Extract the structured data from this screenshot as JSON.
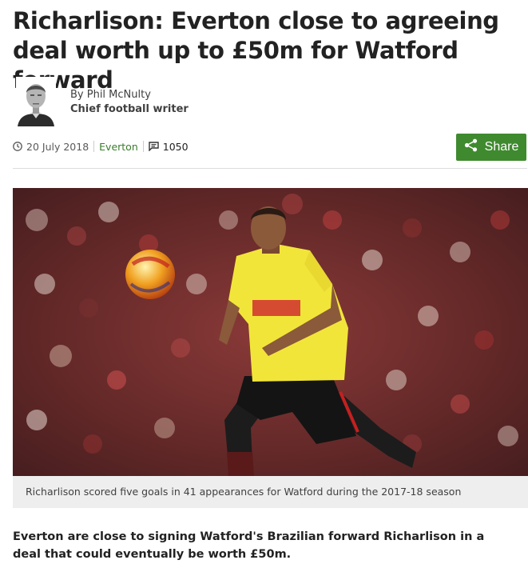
{
  "article": {
    "headline": "Richarlison: Everton close to agreeing deal worth up to £50m for Watford forward",
    "author": "By Phil McNulty",
    "author_role": "Chief football writer",
    "date": "20 July 2018",
    "topic": "Everton",
    "comment_count": "1050",
    "share_label": "Share",
    "image_caption": "Richarlison scored five goals in 41 appearances for Watford during the 2017-18 season",
    "intro": "Everton are close to signing Watford's Brazilian forward Richarlison in a deal that could eventually be worth £50m."
  },
  "icons": {
    "clock": "clock-icon",
    "comments": "comments-icon",
    "share": "share-icon"
  },
  "colors": {
    "share_button": "#3f8a2f",
    "topic_link": "#3a7d2c",
    "caption_bg": "#eeeeee",
    "jersey": "#f2e53a",
    "crowd": "#7a2a2a"
  }
}
